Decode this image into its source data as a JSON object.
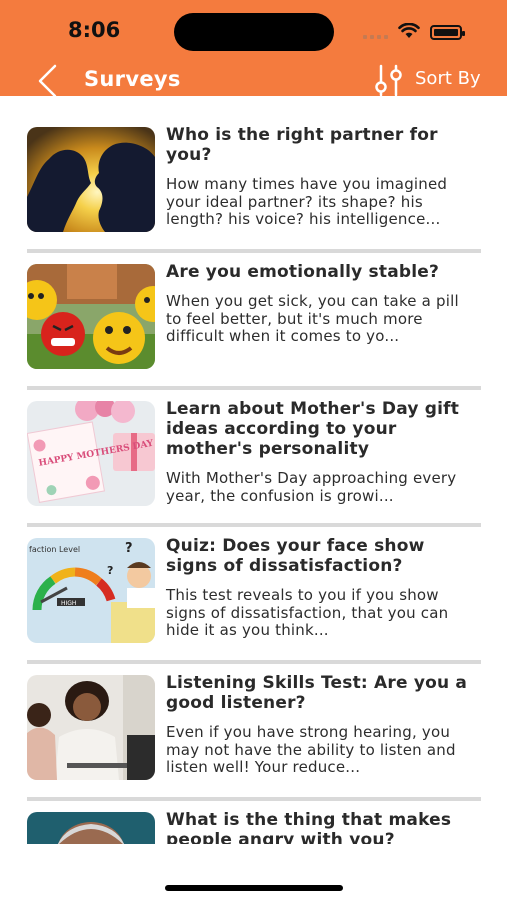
{
  "status": {
    "time": "8:06"
  },
  "nav": {
    "title": "Surveys",
    "sort_label": "Sort By"
  },
  "surveys": [
    {
      "title": "Who is the right partner for you?",
      "description": "How many times have you imagined your ideal partner? its shape? his length? his voice? his intelligence..."
    },
    {
      "title": "Are you emotionally stable?",
      "description": "When you get sick, you can take a pill to feel better, but it's much more difficult when it comes to yo..."
    },
    {
      "title": "Learn about Mother's Day gift ideas according to your mother's personality",
      "description": "With Mother's Day approaching every year, the confusion is growi...",
      "image_text": "HAPPY MOTHERS DAY"
    },
    {
      "title": "Quiz: Does your face show signs of dissatisfaction?",
      "description": "This test reveals to you if you show signs of dissatisfaction, that you can hide it as you think...",
      "image_text": "faction Level",
      "gauge_label": "HIGH"
    },
    {
      "title": "Listening Skills Test: Are you a good listener?",
      "description": "Even if you have strong hearing, you may not have the ability to listen and listen well! Your reduce..."
    },
    {
      "title": "What is the thing that makes people angry with you?",
      "description": ""
    }
  ],
  "colors": {
    "accent": "#f47b3e",
    "divider": "#d9d9d9",
    "text": "#2a2a2a"
  }
}
